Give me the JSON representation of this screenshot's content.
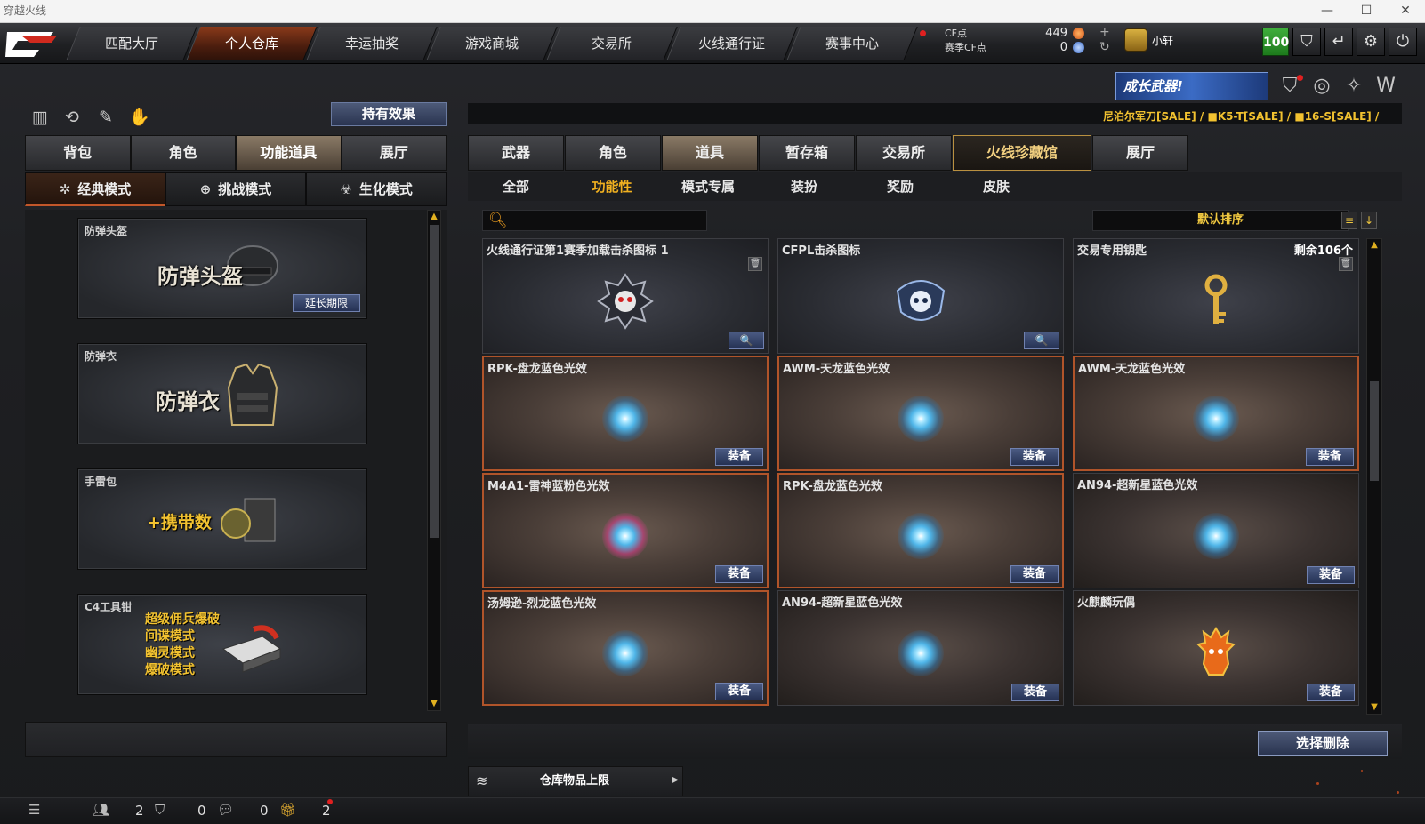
{
  "window": {
    "title": "穿越火线",
    "controls": [
      "—",
      "☐",
      "✕"
    ]
  },
  "nav": {
    "tabs": [
      "匹配大厅",
      "个人仓库",
      "幸运抽奖",
      "游戏商城",
      "交易所",
      "火线通行证",
      "赛事中心"
    ],
    "active": "个人仓库"
  },
  "currency": {
    "cf_label": "CF点",
    "season_label": "赛季CF点",
    "cf_value": "449",
    "season_value": "0"
  },
  "user": {
    "name": "小轩",
    "level": "100"
  },
  "left": {
    "effect_button": "持有效果",
    "tabs": [
      "背包",
      "角色",
      "功能道具",
      "展厅"
    ],
    "active_tab": "功能道具",
    "modes": [
      "经典模式",
      "挑战模式",
      "生化模式"
    ],
    "active_mode": "经典模式",
    "cards": [
      {
        "title": "防弹头盔",
        "big": "防弹头盔",
        "extra": "延长期限"
      },
      {
        "title": "防弹衣",
        "big": "防弹衣"
      },
      {
        "title": "手雷包",
        "big": "+携带数"
      },
      {
        "title": "C4工具钳",
        "lines": [
          "超级佣兵爆破",
          "间谍模式",
          "幽灵模式",
          "爆破模式"
        ]
      }
    ]
  },
  "right": {
    "banner": "成长武器!",
    "marquee": "尼泊尔军刀[SALE] / ■K5-T[SALE] / ■16-S[SALE] /",
    "tabs": [
      "武器",
      "角色",
      "道具",
      "暂存箱",
      "交易所",
      "火线珍藏馆",
      "展厅"
    ],
    "active_tab": "道具",
    "subtabs": [
      "全部",
      "功能性",
      "模式专属",
      "装扮",
      "奖励",
      "皮肤"
    ],
    "active_subtab": "功能性",
    "sort_label": "默认排序",
    "items": [
      {
        "name": "火线通行证第1赛季加载击杀图标 1",
        "kind": "icon",
        "action": "🔍"
      },
      {
        "name": "CFPL击杀图标",
        "kind": "icon",
        "action": "🔍"
      },
      {
        "name": "交易专用钥匙",
        "kind": "key",
        "remain": "剩余106个"
      },
      {
        "name": "RPK-盘龙蓝色光效",
        "kind": "effect",
        "action": "装备"
      },
      {
        "name": "AWM-天龙蓝色光效",
        "kind": "effect",
        "action": "装备"
      },
      {
        "name": "AWM-天龙蓝色光效",
        "kind": "effect",
        "action": "装备"
      },
      {
        "name": "M4A1-雷神蓝粉色光效",
        "kind": "effect-pink",
        "action": "装备"
      },
      {
        "name": "RPK-盘龙蓝色光效",
        "kind": "effect",
        "action": "装备"
      },
      {
        "name": "AN94-超新星蓝色光效",
        "kind": "effect",
        "action": "装备"
      },
      {
        "name": "汤姆逊-烈龙蓝色光效",
        "kind": "effect",
        "action": "装备"
      },
      {
        "name": "AN94-超新星蓝色光效",
        "kind": "effect",
        "action": "装备"
      },
      {
        "name": "火麒麟玩偶",
        "kind": "doll",
        "action": "装备"
      }
    ],
    "delete_button": "选择删除",
    "capacity_label": "仓库物品上限"
  },
  "statusbar": {
    "friends": "2",
    "shield": "0",
    "chat": "0",
    "gift": "2"
  },
  "colors": {
    "accent": "#c2572a",
    "gold": "#f0c840",
    "button_blue": "#2a3450",
    "level_green": "#2a9a28"
  }
}
